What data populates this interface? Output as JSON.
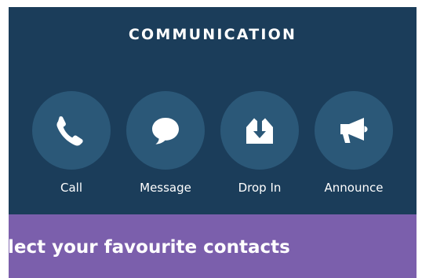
{
  "colors": {
    "panel_background": "#1b3d5a",
    "button_circle": "#2b5878",
    "banner_background": "#7b5fac",
    "text": "#ffffff"
  },
  "header": {
    "title": "COMMUNICATION"
  },
  "actions": [
    {
      "label": "Call",
      "icon": "phone-icon"
    },
    {
      "label": "Message",
      "icon": "speech-bubble-icon"
    },
    {
      "label": "Drop In",
      "icon": "drop-in-icon"
    },
    {
      "label": "Announce",
      "icon": "megaphone-icon"
    }
  ],
  "banner": {
    "text": "lect your favourite contacts"
  }
}
